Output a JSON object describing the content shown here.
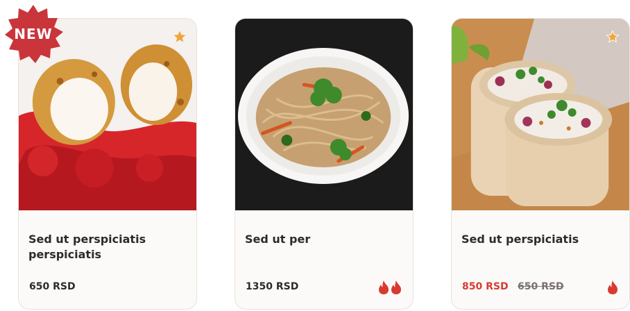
{
  "products": [
    {
      "title": "Sed ut perspiciatis perspiciatis",
      "price": "650 RSD",
      "badge": "NEW",
      "spice_level": 0,
      "favorite_icon": "star-icon"
    },
    {
      "title": "Sed ut per",
      "price": "1350 RSD",
      "spice_level": 2
    },
    {
      "title": "Sed ut perspiciatis",
      "price": "850 RSD",
      "old_price": "650 RSD",
      "spice_level": 1,
      "favorite_icon": "star-icon"
    }
  ],
  "colors": {
    "accent": "#d83a32",
    "badge": "#c9353a",
    "star": "#f2a43a"
  }
}
